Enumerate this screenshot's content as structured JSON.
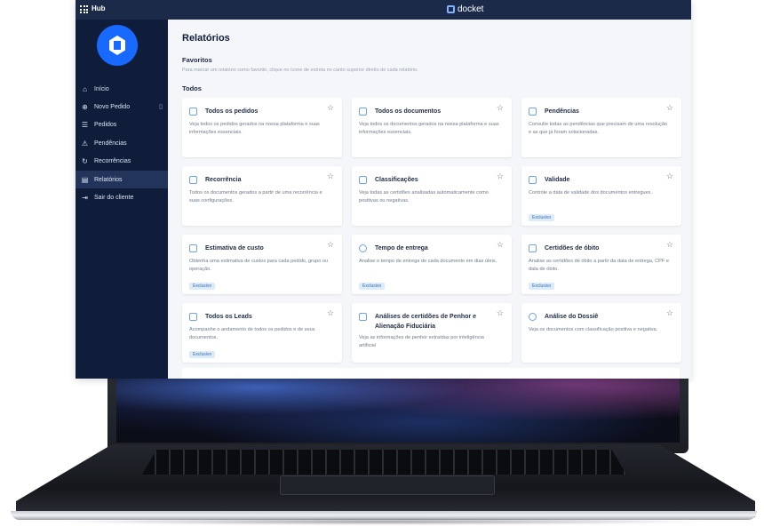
{
  "topbar": {
    "hub_label": "Hub",
    "brand_name": "docket"
  },
  "sidebar": {
    "logo": "docket-logo",
    "items": [
      {
        "label": "Início",
        "icon": "home-icon"
      },
      {
        "label": "Novo Pedido",
        "icon": "plus-icon",
        "extra_icon": "document-icon"
      },
      {
        "label": "Pedidos",
        "icon": "list-icon"
      },
      {
        "label": "Pendências",
        "icon": "warning-icon"
      },
      {
        "label": "Recorrências",
        "icon": "refresh-icon"
      },
      {
        "label": "Relatórios",
        "icon": "chart-icon",
        "active": true
      },
      {
        "label": "Sair do cliente",
        "icon": "exit-icon"
      }
    ]
  },
  "main": {
    "title": "Relatórios",
    "favorites_title": "Favoritos",
    "favorites_hint": "Para marcar um relatório como favorito, clique no ícone de estrela no canto superior direito de cada relatório.",
    "all_title": "Todos",
    "tag_label": "Exclusivo",
    "cards": [
      {
        "title": "Todos os pedidos",
        "desc": "Veja todos os pedidos gerados na nossa plataforma e suas informações essenciais.",
        "exclusive": false,
        "icon": "folder-icon"
      },
      {
        "title": "Todos os documentos",
        "desc": "Veja todos os documentos gerados na nossa plataforma e suas informações essenciais.",
        "exclusive": false,
        "icon": "document-icon"
      },
      {
        "title": "Pendências",
        "desc": "Consulte todas as pendências que precisam de uma resolução e as que já foram solucionadas.",
        "exclusive": false,
        "icon": "warning-icon"
      },
      {
        "title": "Recorrência",
        "desc": "Todos os documentos gerados a partir de uma recorrência e suas configurações.",
        "exclusive": false,
        "icon": "document-icon"
      },
      {
        "title": "Classificações",
        "desc": "Veja todas as certidões analisadas automaticamente como positivas ou negativas.",
        "exclusive": false,
        "icon": "document-icon"
      },
      {
        "title": "Validade",
        "desc": "Controle a data de validade dos documentos entregues.",
        "exclusive": true,
        "icon": "hourglass-icon"
      },
      {
        "title": "Estimativa de custo",
        "desc": "Obtenha uma estimativa de custos para cada pedido, grupo ou operação.",
        "exclusive": true,
        "icon": "calculator-icon"
      },
      {
        "title": "Tempo de entrega",
        "desc": "Analise o tempo de entrega de cada documento em dias úteis.",
        "exclusive": true,
        "icon": "clock-icon"
      },
      {
        "title": "Certidões de óbito",
        "desc": "Analise as certidões de óbito a partir da data de entrega, CPF e data de óbito.",
        "exclusive": true,
        "icon": "document-icon"
      },
      {
        "title": "Todos os Leads",
        "desc": "Acompanhe o andamento de todos os pedidos e de seus documentos.",
        "exclusive": true,
        "icon": "document-icon"
      },
      {
        "title": "Análises de certidões de Penhor e Alienação Fiduciária",
        "desc": "Veja as informações de penhor extraídas por inteligência artificial",
        "exclusive": false,
        "icon": "document-icon"
      },
      {
        "title": "Análise do Dossiê",
        "desc": "Veja os documentos com classificação positiva e negativa.",
        "exclusive": false,
        "icon": "search-document-icon"
      }
    ]
  }
}
